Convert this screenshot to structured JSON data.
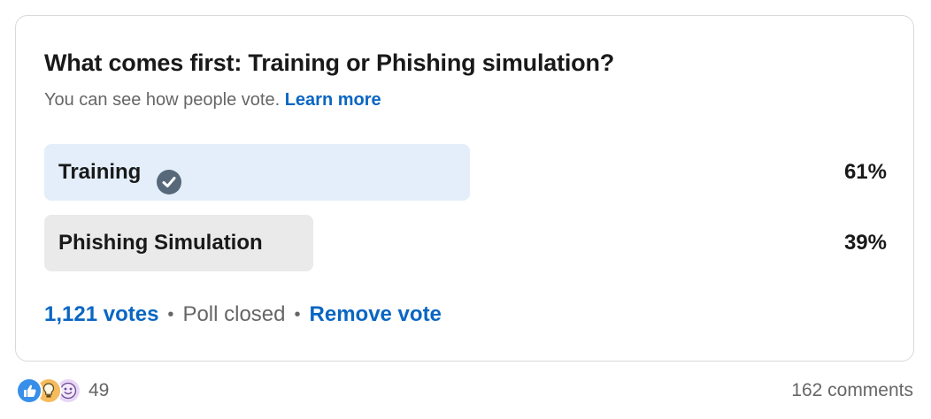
{
  "poll": {
    "question": "What comes first: Training or Phishing simulation?",
    "visibility_note": "You can see how people vote.",
    "learn_more": "Learn more",
    "options": [
      {
        "label": "Training",
        "percent": "61%",
        "share": 0.61,
        "selected": true,
        "bar_color": "#e3eefa"
      },
      {
        "label": "Phishing Simulation",
        "percent": "39%",
        "share": 0.39,
        "selected": false,
        "bar_color": "#eaeaea"
      }
    ],
    "votes": "1,121 votes",
    "status": "Poll closed",
    "remove_vote": "Remove vote",
    "separator": "•"
  },
  "social": {
    "reaction_icons": [
      "like-icon",
      "insightful-icon",
      "funny-icon"
    ],
    "reactions_count": "49",
    "comments": "162 comments"
  },
  "colors": {
    "link": "#0a66c2",
    "check": "#56687a",
    "muted_text": "#666666"
  }
}
